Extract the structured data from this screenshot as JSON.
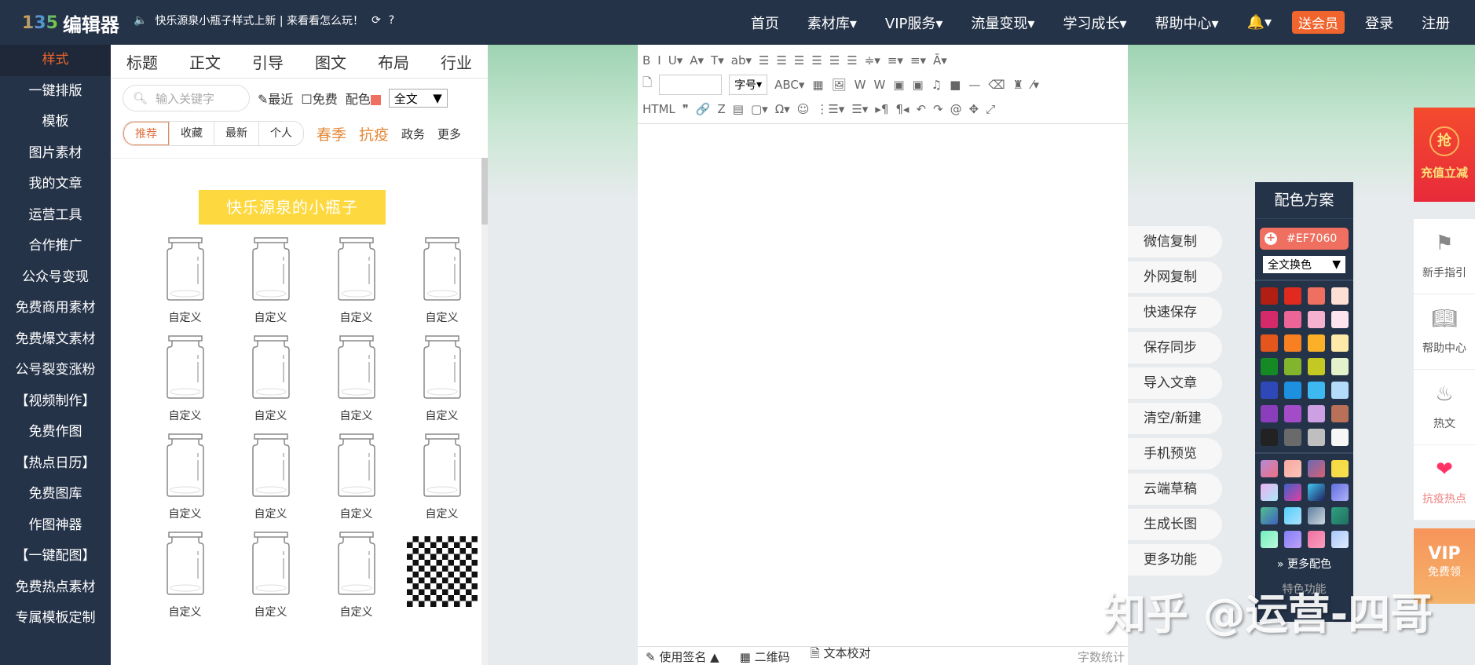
{
  "header": {
    "logo_mark": "135",
    "logo_text": "编辑器",
    "notice": "快乐源泉小瓶子样式上新 | 来看看怎么玩！",
    "nav": [
      "首页",
      "素材库▾",
      "VIP服务▾",
      "流量变现▾",
      "学习成长▾",
      "帮助中心▾"
    ],
    "bell": "🔔▾",
    "vip_badge": "送会员",
    "login": "登录",
    "register": "注册"
  },
  "left_nav": [
    "样式",
    "一键排版",
    "模板",
    "图片素材",
    "我的文章",
    "运营工具",
    "合作推广",
    "公众号变现",
    "免费商用素材",
    "免费爆文素材",
    "公号裂变涨粉",
    "【视频制作】",
    "免费作图",
    "【热点日历】",
    "免费图库",
    "作图神器",
    "【一键配图】",
    "免费热点素材",
    "专属模板定制"
  ],
  "panel": {
    "tabs": [
      "标题",
      "正文",
      "引导",
      "图文",
      "布局",
      "行业"
    ],
    "search_placeholder": "输入关键字",
    "recent": "最近",
    "free": "免费",
    "color_label": "配色",
    "scope": "全文",
    "filters": [
      "推荐",
      "收藏",
      "最新",
      "个人"
    ],
    "hot_tags": [
      "春季",
      "抗疫"
    ],
    "plain_tags": [
      "政务",
      "更多"
    ],
    "banner": "快乐源泉的小瓶子",
    "jar_label": "自定义"
  },
  "editor": {
    "font_size": "字号",
    "footer": {
      "signature": "使用签名 ▲",
      "qrcode": "二维码",
      "proofread": "文本校对",
      "word_count": "字数统计"
    }
  },
  "actions": [
    "微信复制",
    "外网复制",
    "快速保存",
    "保存同步",
    "导入文章",
    "清空/新建",
    "手机预览",
    "云端草稿",
    "生成长图",
    "更多功能"
  ],
  "palette": {
    "title": "配色方案",
    "current": "#EF7060",
    "mode": "全文换色",
    "more": "更多配色",
    "feature": "特色功能",
    "colors": [
      "#b01e14",
      "#e02a20",
      "#ef7060",
      "#fde0d4",
      "#d42a6a",
      "#ec6596",
      "#f4b2cf",
      "#fde4ee",
      "#e4561c",
      "#f88020",
      "#fbb028",
      "#fde9a8",
      "#158a24",
      "#82b42e",
      "#c4c822",
      "#e4f2cc",
      "#2e48b8",
      "#1e90e0",
      "#3eb8f0",
      "#b2dcfa",
      "#8a3ebc",
      "#a24cc8",
      "#cca0e2",
      "#b87058",
      "#222222",
      "#6a6a6a",
      "#bfbfbf",
      "#f6f6f6"
    ],
    "gradients": [
      "linear-gradient(135deg,#b48ad8,#f07080)",
      "linear-gradient(135deg,#f7a8a0,#fbc4b8)",
      "linear-gradient(135deg,#6a6ab8,#d86070)",
      "linear-gradient(135deg,#f5d840,#f8e050)",
      "linear-gradient(135deg,#f0b0f0,#a8e8f8)",
      "linear-gradient(135deg,#4060c8,#e040a0)",
      "linear-gradient(135deg,#40c8f0,#202060)",
      "linear-gradient(135deg,#6070e0,#b0b0f8)",
      "linear-gradient(135deg,#50c090,#4060c0)",
      "linear-gradient(135deg,#50d0f8,#b0e0ff)",
      "linear-gradient(135deg,#6080a0,#d0d8e0)",
      "linear-gradient(135deg,#30a080,#207060)",
      "linear-gradient(135deg,#70f0c0,#c0f8d8)",
      "linear-gradient(135deg,#8080f8,#c0a0f8)",
      "linear-gradient(135deg,#f070a0,#f8a0c0)",
      "linear-gradient(135deg,#a8c8f8,#e0ecff)"
    ]
  },
  "right_side": {
    "promo": "充值立减",
    "promo_badge": "抢",
    "items": [
      "新手指引",
      "帮助中心",
      "热文",
      "抗疫热点"
    ],
    "vip": "VIP",
    "vip_label": "免费领"
  },
  "watermark": "知乎 @运营-四哥"
}
